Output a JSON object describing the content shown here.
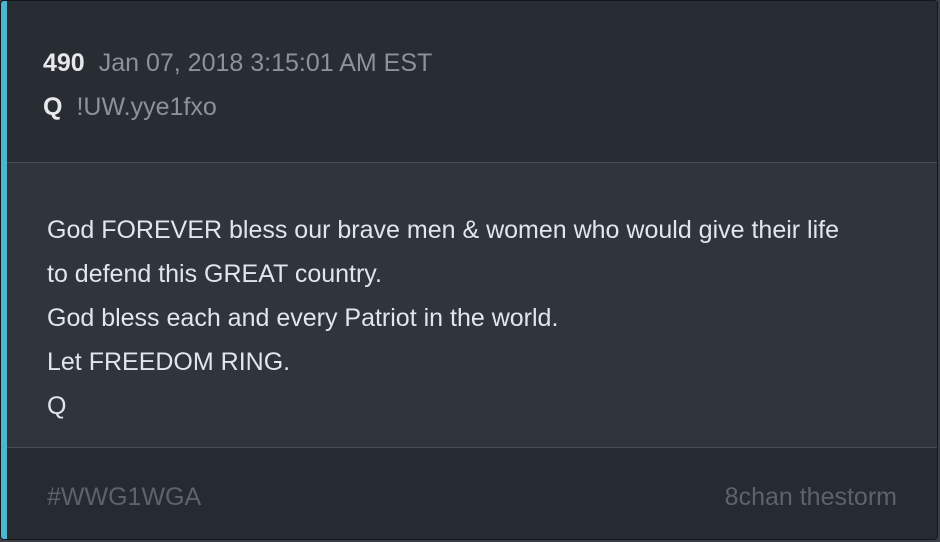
{
  "post": {
    "number": "490",
    "timestamp": "Jan 07, 2018 3:15:01 AM EST",
    "author": "Q",
    "tripcode": "!UW.yye1fxo",
    "message_lines": [
      "God FOREVER bless our brave men & women who would give their life",
      "to defend this GREAT country.",
      "God bless each and every Patriot in the world.",
      "Let FREEDOM RING.",
      "Q"
    ]
  },
  "footer": {
    "hashtag": "#WWG1WGA",
    "source": "8chan thestorm"
  },
  "colors": {
    "accent": "#4fb6cf",
    "header_bg": "#282c33",
    "body_bg": "#2f343d",
    "footer_bg": "#262a31"
  }
}
